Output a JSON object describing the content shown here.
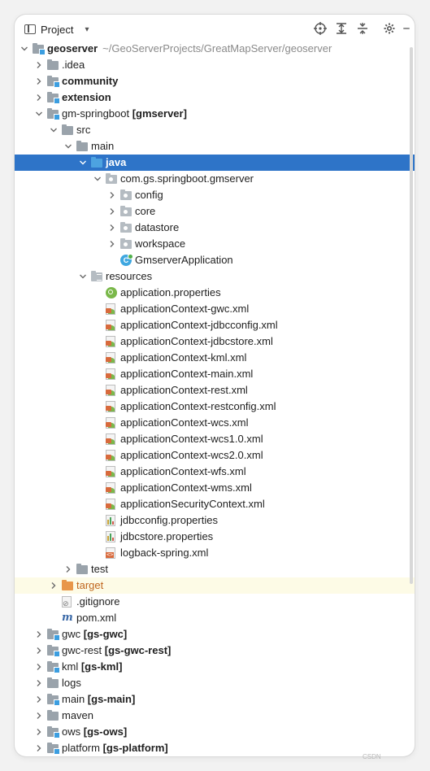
{
  "header": {
    "title": "Project",
    "tools": [
      "locate-icon",
      "expand-all-icon",
      "collapse-all-icon",
      "settings-icon",
      "minimize-icon"
    ]
  },
  "tree": [
    {
      "depth": 0,
      "arrow": "down",
      "icon": "module-folder",
      "name": "geoserver",
      "bold": true,
      "path": "~/GeoServerProjects/GreatMapServer/geoserver"
    },
    {
      "depth": 1,
      "arrow": "right",
      "icon": "folder",
      "name": ".idea"
    },
    {
      "depth": 1,
      "arrow": "right",
      "icon": "module-folder",
      "name": "community",
      "bold": true
    },
    {
      "depth": 1,
      "arrow": "right",
      "icon": "module-folder",
      "name": "extension",
      "bold": true
    },
    {
      "depth": 1,
      "arrow": "down",
      "icon": "module-folder",
      "name": "gm-springboot ",
      "tag": "[gmserver]"
    },
    {
      "depth": 2,
      "arrow": "down",
      "icon": "folder",
      "name": "src"
    },
    {
      "depth": 3,
      "arrow": "down",
      "icon": "folder",
      "name": "main"
    },
    {
      "depth": 4,
      "arrow": "down",
      "icon": "folder-blue",
      "name": "java",
      "bold": true,
      "selected": true
    },
    {
      "depth": 5,
      "arrow": "down",
      "icon": "package",
      "name": "com.gs.springboot.gmserver"
    },
    {
      "depth": 6,
      "arrow": "right",
      "icon": "package",
      "name": "config"
    },
    {
      "depth": 6,
      "arrow": "right",
      "icon": "package",
      "name": "core"
    },
    {
      "depth": 6,
      "arrow": "right",
      "icon": "package",
      "name": "datastore"
    },
    {
      "depth": 6,
      "arrow": "right",
      "icon": "package",
      "name": "workspace"
    },
    {
      "depth": 6,
      "arrow": "none",
      "icon": "class",
      "name": "GmserverApplication"
    },
    {
      "depth": 4,
      "arrow": "down",
      "icon": "resources",
      "name": "resources"
    },
    {
      "depth": 5,
      "arrow": "none",
      "icon": "app-props",
      "name": "application.properties"
    },
    {
      "depth": 5,
      "arrow": "none",
      "icon": "xml",
      "name": "applicationContext-gwc.xml"
    },
    {
      "depth": 5,
      "arrow": "none",
      "icon": "xml",
      "name": "applicationContext-jdbcconfig.xml"
    },
    {
      "depth": 5,
      "arrow": "none",
      "icon": "xml",
      "name": "applicationContext-jdbcstore.xml"
    },
    {
      "depth": 5,
      "arrow": "none",
      "icon": "xml",
      "name": "applicationContext-kml.xml"
    },
    {
      "depth": 5,
      "arrow": "none",
      "icon": "xml",
      "name": "applicationContext-main.xml"
    },
    {
      "depth": 5,
      "arrow": "none",
      "icon": "xml",
      "name": "applicationContext-rest.xml"
    },
    {
      "depth": 5,
      "arrow": "none",
      "icon": "xml",
      "name": "applicationContext-restconfig.xml"
    },
    {
      "depth": 5,
      "arrow": "none",
      "icon": "xml",
      "name": "applicationContext-wcs.xml"
    },
    {
      "depth": 5,
      "arrow": "none",
      "icon": "xml",
      "name": "applicationContext-wcs1.0.xml"
    },
    {
      "depth": 5,
      "arrow": "none",
      "icon": "xml",
      "name": "applicationContext-wcs2.0.xml"
    },
    {
      "depth": 5,
      "arrow": "none",
      "icon": "xml",
      "name": "applicationContext-wfs.xml"
    },
    {
      "depth": 5,
      "arrow": "none",
      "icon": "xml",
      "name": "applicationContext-wms.xml"
    },
    {
      "depth": 5,
      "arrow": "none",
      "icon": "xml",
      "name": "applicationSecurityContext.xml"
    },
    {
      "depth": 5,
      "arrow": "none",
      "icon": "props",
      "name": "jdbcconfig.properties"
    },
    {
      "depth": 5,
      "arrow": "none",
      "icon": "props",
      "name": "jdbcstore.properties"
    },
    {
      "depth": 5,
      "arrow": "none",
      "icon": "logback",
      "name": "logback-spring.xml"
    },
    {
      "depth": 3,
      "arrow": "right",
      "icon": "folder",
      "name": "test"
    },
    {
      "depth": 2,
      "arrow": "right",
      "icon": "folder-orange",
      "name": "target",
      "orange": true,
      "highlight": true
    },
    {
      "depth": 2,
      "arrow": "none",
      "icon": "gitignore",
      "name": ".gitignore"
    },
    {
      "depth": 2,
      "arrow": "none",
      "icon": "pom",
      "name": "pom.xml"
    },
    {
      "depth": 1,
      "arrow": "right",
      "icon": "module-folder",
      "name": "gwc ",
      "tag": "[gs-gwc]"
    },
    {
      "depth": 1,
      "arrow": "right",
      "icon": "module-folder",
      "name": "gwc-rest ",
      "tag": "[gs-gwc-rest]"
    },
    {
      "depth": 1,
      "arrow": "right",
      "icon": "module-folder",
      "name": "kml ",
      "tag": "[gs-kml]"
    },
    {
      "depth": 1,
      "arrow": "right",
      "icon": "folder",
      "name": "logs"
    },
    {
      "depth": 1,
      "arrow": "right",
      "icon": "module-folder",
      "name": "main ",
      "tag": "[gs-main]"
    },
    {
      "depth": 1,
      "arrow": "right",
      "icon": "folder",
      "name": "maven"
    },
    {
      "depth": 1,
      "arrow": "right",
      "icon": "module-folder",
      "name": "ows ",
      "tag": "[gs-ows]"
    },
    {
      "depth": 1,
      "arrow": "right",
      "icon": "module-folder",
      "name": "platform ",
      "tag": "[gs-platform]"
    }
  ],
  "colors": {
    "selection": "#2e74c8",
    "highlight": "#fdfbe6",
    "path": "#8a8a8a"
  }
}
